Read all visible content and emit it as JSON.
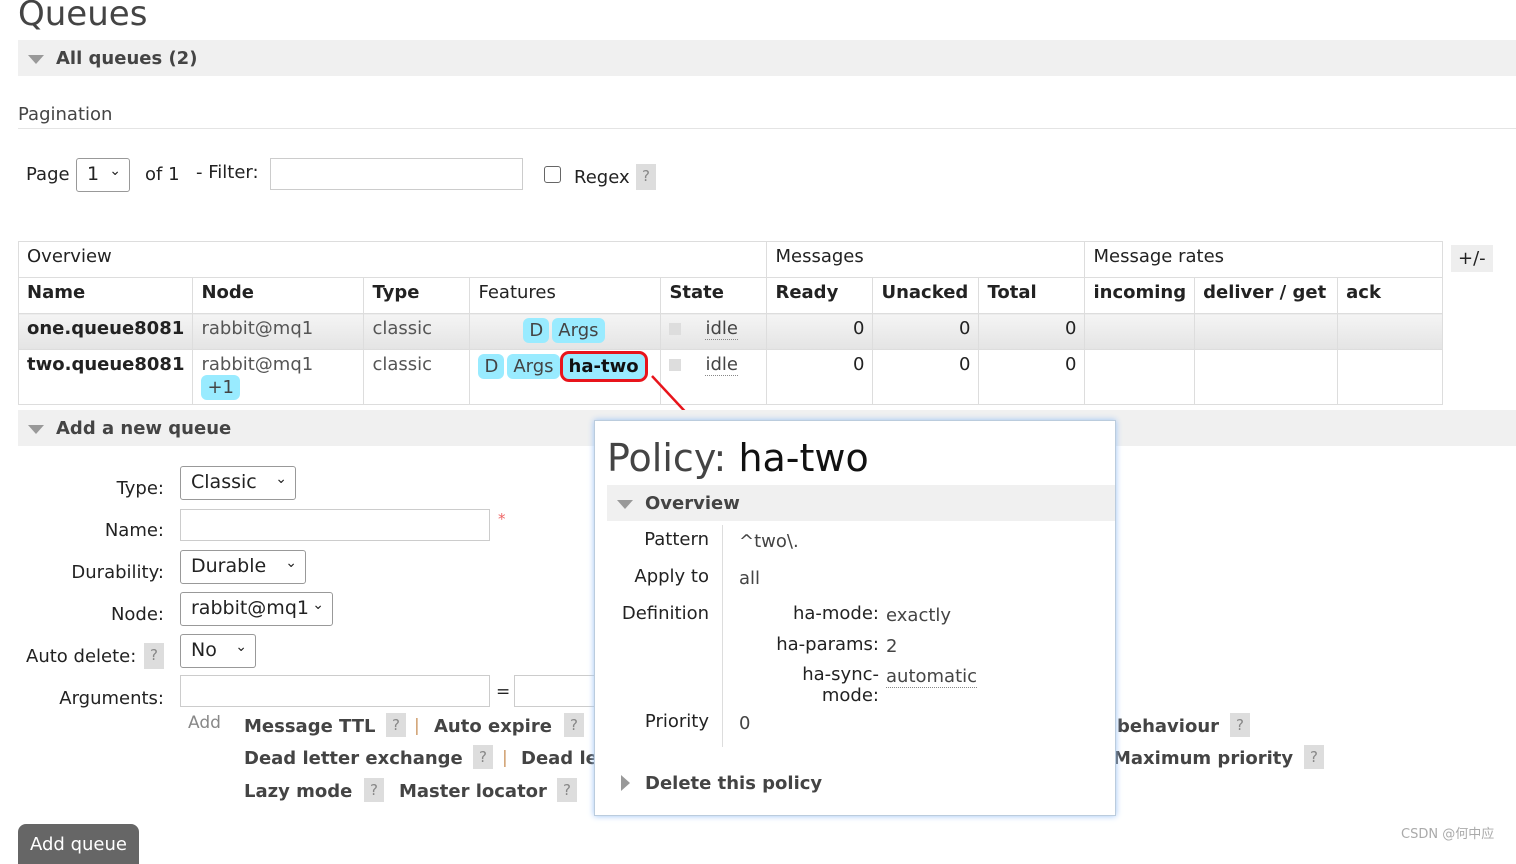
{
  "page_title": "Queues",
  "all_queues": "All queues (2)",
  "pagination": {
    "label": "Pagination",
    "page_label": "Page",
    "page_value": "1",
    "of": "of 1",
    "filter_label": "- Filter:",
    "filter_value": "",
    "regex_label": "Regex",
    "help": "?"
  },
  "table": {
    "groups": [
      "Overview",
      "Messages",
      "Message rates"
    ],
    "toggle": "+/-",
    "headers": [
      "Name",
      "Node",
      "Type",
      "Features",
      "State",
      "Ready",
      "Unacked",
      "Total",
      "incoming",
      "deliver / get",
      "ack"
    ],
    "rows": [
      {
        "name": "one.queue8081",
        "node": "rabbit@mq1",
        "node_extra": "",
        "type": "classic",
        "features": [
          "D",
          "Args"
        ],
        "policy": "",
        "state": "idle",
        "ready": "0",
        "unacked": "0",
        "total": "0"
      },
      {
        "name": "two.queue8081",
        "node": "rabbit@mq1",
        "node_extra": "+1",
        "type": "classic",
        "features": [
          "D",
          "Args"
        ],
        "policy": "ha-two",
        "state": "idle",
        "ready": "0",
        "unacked": "0",
        "total": "0"
      }
    ]
  },
  "add_queue": {
    "title": "Add a new queue",
    "type_label": "Type:",
    "type_value": "Classic",
    "name_label": "Name:",
    "name_value": "",
    "required": "*",
    "durability_label": "Durability:",
    "durability_value": "Durable",
    "node_label": "Node:",
    "node_value": "rabbit@mq1",
    "auto_delete_label": "Auto delete:",
    "auto_delete_value": "No",
    "arguments_label": "Arguments:",
    "equals": "=",
    "add": "Add",
    "args": [
      "Message TTL",
      "Auto expire",
      "behaviour",
      "Dead letter exchange",
      "Dead le",
      "Maximum priority",
      "Lazy mode",
      "Master locator"
    ],
    "button": "Add queue"
  },
  "popup": {
    "title_prefix": "Policy:",
    "title_name": "ha-two",
    "overview": "Overview",
    "pattern_label": "Pattern",
    "pattern": "^two\\.",
    "apply_label": "Apply to",
    "apply": "all",
    "definition_label": "Definition",
    "definition": [
      {
        "k": "ha-mode:",
        "v": "exactly"
      },
      {
        "k": "ha-params:",
        "v": "2"
      },
      {
        "k": "ha-sync-mode:",
        "v": "automatic"
      }
    ],
    "priority_label": "Priority",
    "priority": "0",
    "delete": "Delete this policy"
  },
  "watermark": "CSDN @何中应",
  "highlight_color": "#e8141b"
}
